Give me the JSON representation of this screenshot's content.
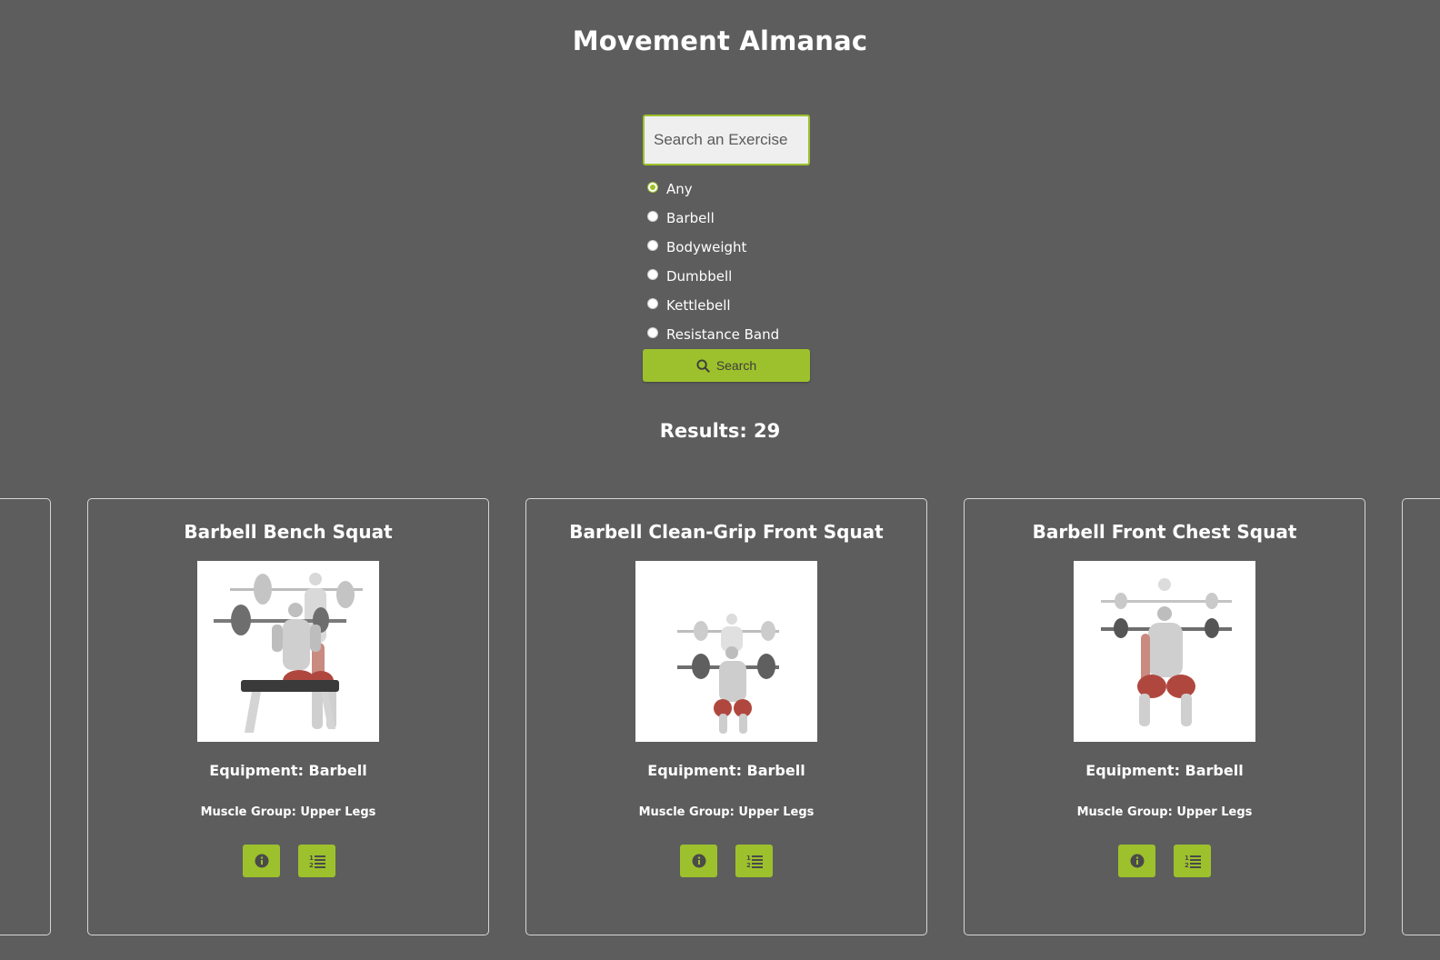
{
  "header": {
    "title": "Movement Almanac"
  },
  "search": {
    "placeholder": "Search an Exercise",
    "button_label": "Search"
  },
  "equipment_filter": {
    "selected": "Any",
    "options": [
      "Any",
      "Barbell",
      "Bodyweight",
      "Dumbbell",
      "Kettlebell",
      "Resistance Band"
    ]
  },
  "results": {
    "label": "Results: 29"
  },
  "cards": [
    {
      "name": "Barbell Bench Squat",
      "equipment": "Equipment: Barbell",
      "muscle_group": "Muscle Group: Upper Legs"
    },
    {
      "name": "Barbell Clean-Grip Front Squat",
      "equipment": "Equipment: Barbell",
      "muscle_group": "Muscle Group: Upper Legs"
    },
    {
      "name": "Barbell Front Chest Squat",
      "equipment": "Equipment: Barbell",
      "muscle_group": "Muscle Group: Upper Legs"
    }
  ],
  "icons": {
    "search": "magnifier-icon",
    "info": "info-circle-icon",
    "steps": "numbered-list-icon"
  },
  "colors": {
    "background": "#5d5d5d",
    "accent": "#9dc12c",
    "text": "#ffffff"
  }
}
